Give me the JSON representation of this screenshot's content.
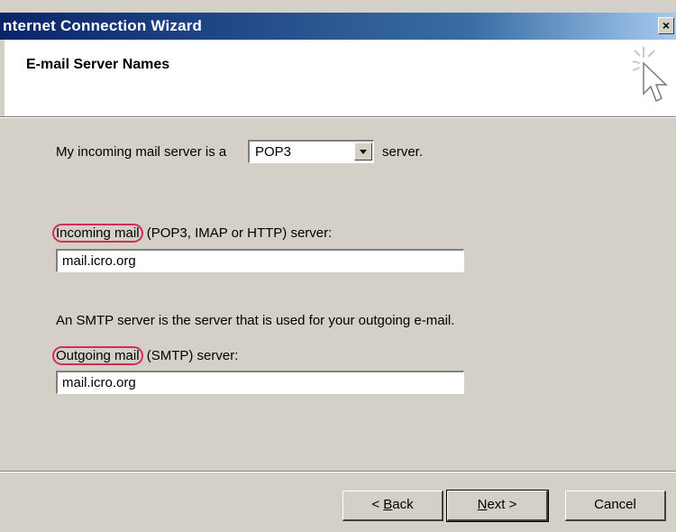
{
  "window": {
    "title": "nternet Connection Wizard",
    "close_glyph": "×"
  },
  "header": {
    "title": "E-mail Server Names",
    "icon": "wizard-cursor-icon"
  },
  "server_type": {
    "prefix": "My incoming mail server is a",
    "selected": "POP3",
    "suffix": "server."
  },
  "incoming": {
    "label_circled": "Incoming mail",
    "label_rest": " (POP3, IMAP or HTTP) server:",
    "value": "mail.icro.org"
  },
  "smtp_note": "An SMTP server is the server that is used for your outgoing e-mail.",
  "outgoing": {
    "label_circled": "Outgoing mail",
    "label_rest": " (SMTP) server:",
    "value": "mail.icro.org"
  },
  "buttons": {
    "back_prefix": "< ",
    "back_mnemonic": "B",
    "back_rest": "ack",
    "next_mnemonic": "N",
    "next_rest": "ext >",
    "cancel": "Cancel"
  },
  "colors": {
    "titlebar_start": "#0a246a",
    "titlebar_end": "#a6caf0",
    "highlight_circle": "#d22e55",
    "dialog_face": "#d4d0c8"
  }
}
